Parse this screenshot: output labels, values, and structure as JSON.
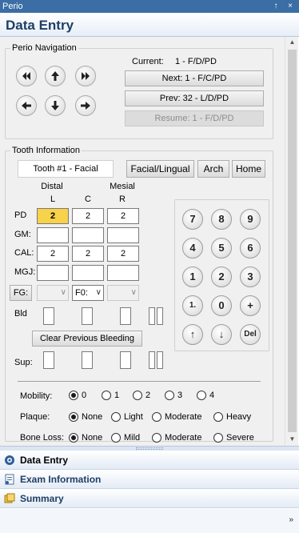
{
  "window": {
    "title": "Perio",
    "pin_glyph": "↑",
    "close_glyph": "×"
  },
  "header": {
    "title": "Data Entry"
  },
  "perio_navigation": {
    "legend": "Perio Navigation",
    "current_label": "Current:",
    "current_value": "1 - F/D/PD",
    "next_label": "Next:   1 - F/C/PD",
    "prev_label": "Prev:   32 - L/D/PD",
    "resume_label": "Resume:  1 - F/D/PD"
  },
  "tooth_information": {
    "legend": "Tooth Information",
    "tooth_label": "Tooth #1 - Facial",
    "buttons": {
      "facial_lingual": "Facial/Lingual",
      "arch": "Arch",
      "home": "Home"
    },
    "columns": {
      "distal_top": "Distal",
      "distal": "L",
      "center": "C",
      "mesial_top": "Mesial",
      "mesial": "R"
    },
    "rows": {
      "pd": {
        "label": "PD",
        "values": [
          "2",
          "2",
          "2"
        ]
      },
      "gm": {
        "label": "GM:",
        "values": [
          "",
          "",
          ""
        ]
      },
      "cal": {
        "label": "CAL:",
        "values": [
          "2",
          "2",
          "2"
        ]
      },
      "mgj": {
        "label": "MGJ:",
        "values": [
          "",
          "",
          ""
        ]
      }
    },
    "fg": {
      "label": "FG:",
      "middle_value": "F0:"
    },
    "bld_label": "Bld",
    "clear_bleeding": "Clear Previous Bleeding",
    "sup_label": "Sup:",
    "keypad": [
      "7",
      "8",
      "9",
      "4",
      "5",
      "6",
      "1",
      "2",
      "3",
      "1.",
      "0",
      "+",
      "↑",
      "↓",
      "Del"
    ]
  },
  "mobility": {
    "label": "Mobility:",
    "options": [
      "0",
      "1",
      "2",
      "3",
      "4"
    ],
    "selected": "0"
  },
  "plaque": {
    "label": "Plaque:",
    "options": [
      "None",
      "Light",
      "Moderate",
      "Heavy"
    ],
    "selected": "None"
  },
  "bone_loss": {
    "label": "Bone Loss:",
    "options": [
      "None",
      "Mild",
      "Moderate",
      "Severe"
    ],
    "selected": "None"
  },
  "nav_panel": {
    "items": [
      {
        "label": "Data Entry",
        "icon": "data-entry-icon"
      },
      {
        "label": "Exam Information",
        "icon": "exam-information-icon"
      },
      {
        "label": "Summary",
        "icon": "summary-icon"
      }
    ],
    "more_glyph": "»"
  },
  "colors": {
    "accent": "#1e3f66",
    "highlight": "#f7d24a",
    "titlebar": "#3a6ea5"
  }
}
